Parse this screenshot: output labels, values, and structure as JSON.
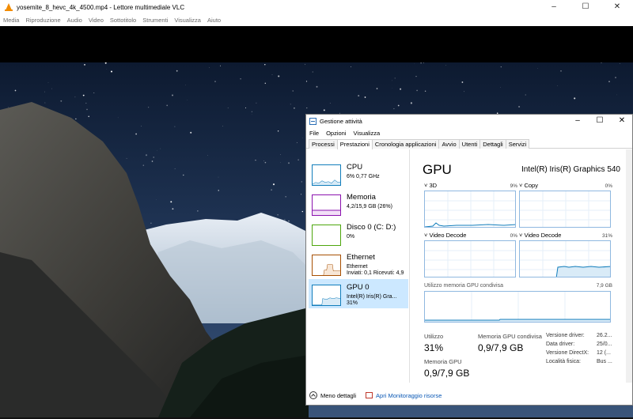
{
  "vlc": {
    "title": "yosemite_8_hevc_4k_4500.mp4 - Lettore multimediale VLC",
    "menu": [
      "Media",
      "Riproduzione",
      "Audio",
      "Video",
      "Sottotitolo",
      "Strumenti",
      "Visualizza",
      "Aiuto"
    ],
    "window_controls": {
      "minimize": "–",
      "maximize": "☐",
      "close": "✕"
    }
  },
  "taskmanager": {
    "title": "Gestione attività",
    "window_controls": {
      "minimize": "–",
      "maximize": "☐",
      "close": "✕"
    },
    "menu": [
      "File",
      "Opzioni",
      "Visualizza"
    ],
    "tabs": [
      "Processi",
      "Prestazioni",
      "Cronologia applicazioni",
      "Avvio",
      "Utenti",
      "Dettagli",
      "Servizi"
    ],
    "active_tab": "Prestazioni",
    "resources": [
      {
        "name": "CPU",
        "sub1": "6% 0,77 GHz",
        "sub2": "",
        "sub3": "",
        "color": "#117dbb"
      },
      {
        "name": "Memoria",
        "sub1": "4,2/15,9 GB (26%)",
        "sub2": "",
        "sub3": "",
        "color": "#8b12ae"
      },
      {
        "name": "Disco 0 (C: D:)",
        "sub1": "0%",
        "sub2": "",
        "sub3": "",
        "color": "#4da60c"
      },
      {
        "name": "Ethernet",
        "sub1": "Ethernet",
        "sub2": "Inviati: 0,1 Ricevuti: 4,9",
        "sub3": "",
        "color": "#a74f01"
      },
      {
        "name": "GPU 0",
        "sub1": "Intel(R) Iris(R) Gra...",
        "sub2": "31%",
        "sub3": "",
        "color": "#117dbb"
      }
    ],
    "gpu": {
      "title": "GPU",
      "model": "Intel(R) Iris(R) Graphics 540",
      "graphs": [
        {
          "label": "3D",
          "pct": "9%",
          "level": 0.09
        },
        {
          "label": "Copy",
          "pct": "0%",
          "level": 0.0
        },
        {
          "label": "Video Decode",
          "pct": "0%",
          "level": 0.0
        },
        {
          "label": "Video Decode",
          "pct": "31%",
          "level": 0.31
        }
      ],
      "shared_memory_label": "Utilizzo memoria GPU condivisa",
      "shared_memory_max": "7,9 GB",
      "stats": {
        "utilizzo_label": "Utilizzo",
        "utilizzo_value": "31%",
        "mem_shared_label": "Memoria GPU condivisa",
        "mem_shared_value": "0,9/7,9 GB",
        "mem_label": "Memoria GPU",
        "mem_value": "0,9/7,9 GB"
      },
      "details": [
        {
          "key": "Versione driver:",
          "value": "26.2..."
        },
        {
          "key": "Data driver:",
          "value": "25/0..."
        },
        {
          "key": "Versione DirectX:",
          "value": "12 (..."
        },
        {
          "key": "Località fisica:",
          "value": "Bus ..."
        }
      ]
    },
    "footer": {
      "less_details": "Meno dettagli",
      "open_monitor": "Apri Monitoraggio risorse"
    }
  }
}
